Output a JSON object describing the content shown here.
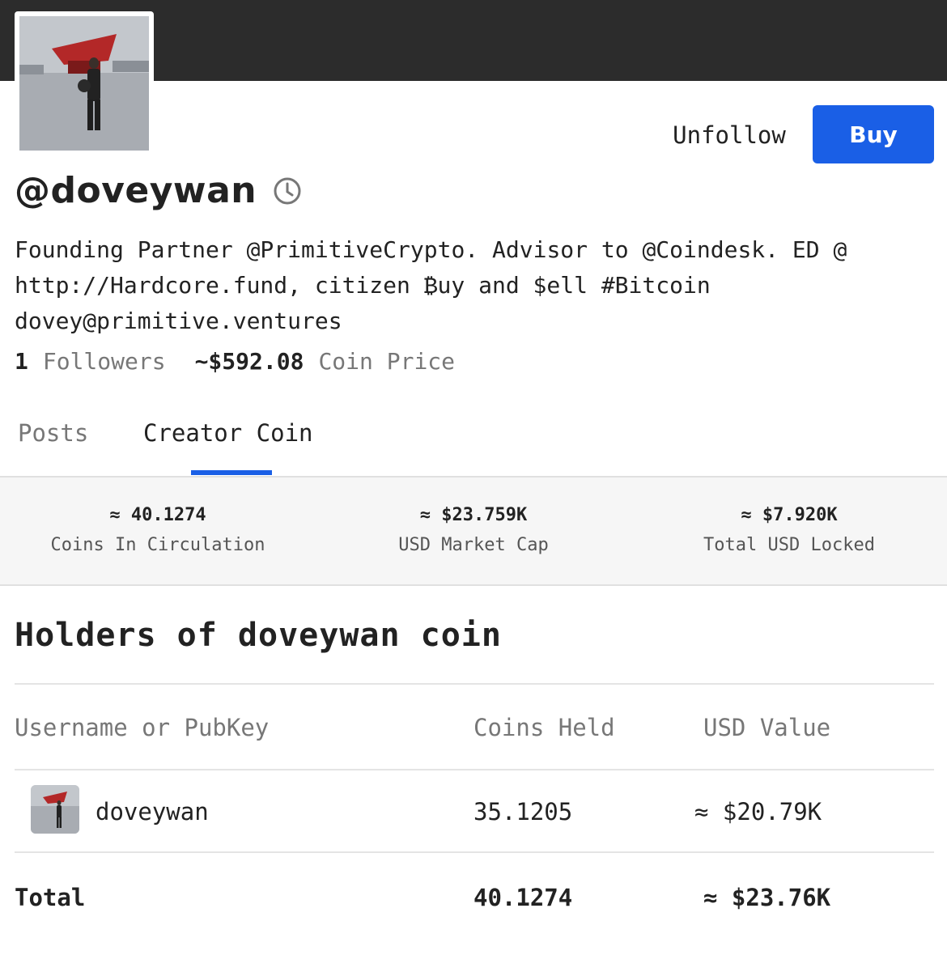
{
  "profile": {
    "username": "@doveywan",
    "bio_line1": "Founding Partner @PrimitiveCrypto. Advisor to @Coindesk. ED @",
    "bio_line2": "http://Hardcore.fund, citizen ₿uy and $ell #Bitcoin",
    "bio_line3": "dovey@primitive.ventures",
    "followers_count": "1",
    "followers_label": "Followers",
    "coin_price": "~$592.08",
    "coin_price_label": "Coin Price"
  },
  "actions": {
    "unfollow_label": "Unfollow",
    "buy_label": "Buy"
  },
  "tabs": [
    {
      "label": "Posts",
      "active": false
    },
    {
      "label": "Creator Coin",
      "active": true
    }
  ],
  "coin_stats": [
    {
      "value": "≈ 40.1274",
      "label": "Coins In Circulation"
    },
    {
      "value": "≈ $23.759K",
      "label": "USD Market Cap"
    },
    {
      "value": "≈ $7.920K",
      "label": "Total USD Locked"
    }
  ],
  "holders": {
    "title": "Holders of doveywan coin",
    "columns": [
      "Username or PubKey",
      "Coins Held",
      "USD Value"
    ],
    "rows": [
      {
        "name": "doveywan",
        "coins": "35.1205",
        "usd": "≈ $20.79K"
      }
    ],
    "total": {
      "label": "Total",
      "coins": "40.1274",
      "usd": "≈ $23.76K"
    }
  },
  "colors": {
    "accent": "#1a5fe6",
    "banner": "#2c2c2c"
  }
}
